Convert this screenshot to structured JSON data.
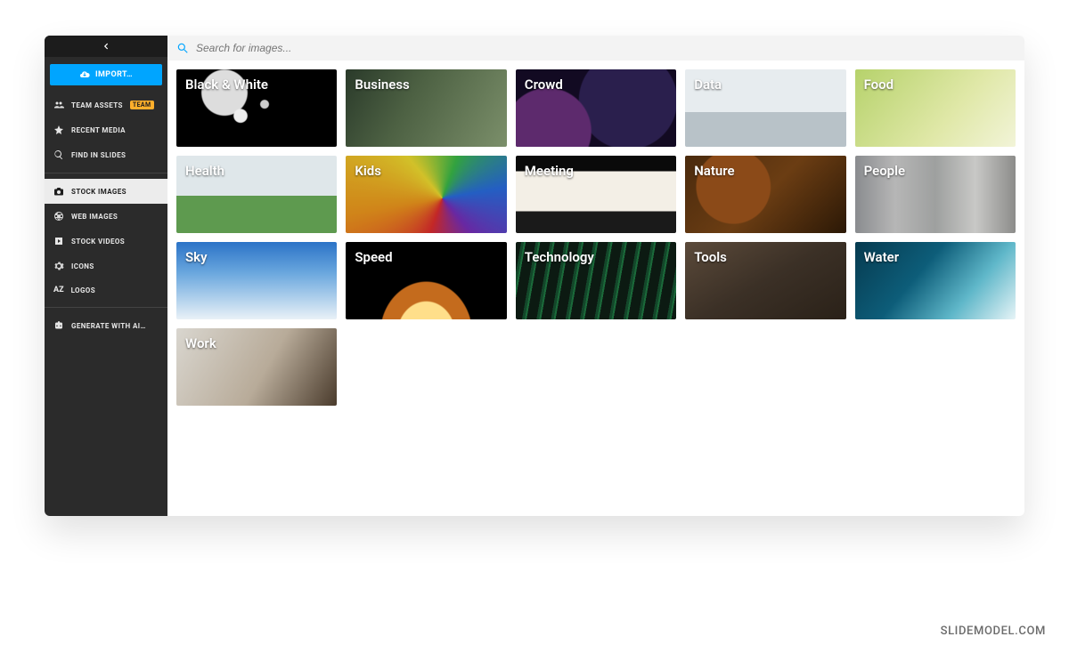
{
  "sidebar": {
    "import_label": "IMPORT…",
    "nav1": [
      {
        "label": "TEAM ASSETS",
        "badge": "TEAM"
      },
      {
        "label": "RECENT MEDIA"
      },
      {
        "label": "FIND IN SLIDES"
      }
    ],
    "nav2": [
      {
        "label": "STOCK IMAGES",
        "active": true
      },
      {
        "label": "WEB IMAGES"
      },
      {
        "label": "STOCK VIDEOS"
      },
      {
        "label": "ICONS"
      },
      {
        "label": "LOGOS"
      }
    ],
    "nav3": [
      {
        "label": "GENERATE WITH AI…"
      }
    ]
  },
  "search": {
    "placeholder": "Search for images..."
  },
  "categories": [
    "Black & White",
    "Business",
    "Crowd",
    "Data",
    "Food",
    "Health",
    "Kids",
    "Meeting",
    "Nature",
    "People",
    "Sky",
    "Speed",
    "Technology",
    "Tools",
    "Water",
    "Work"
  ],
  "watermark": "SLIDEMODEL.COM"
}
